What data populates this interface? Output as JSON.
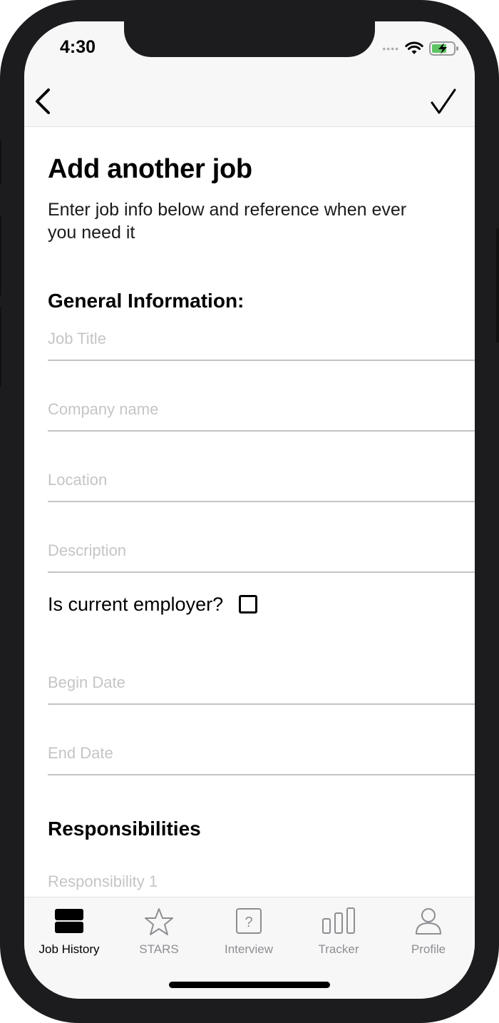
{
  "status_bar": {
    "time": "4:30",
    "icons": [
      "signal-dots-icon",
      "wifi-icon",
      "battery-charging-icon"
    ],
    "battery_color": "#5fc463"
  },
  "nav": {
    "back_icon": "chevron-left-icon",
    "done_icon": "checkmark-icon"
  },
  "page": {
    "title": "Add another job",
    "subtitle": "Enter job info below and reference when ever you need it"
  },
  "general": {
    "heading": "General Information:",
    "fields": [
      {
        "placeholder": "Job Title",
        "value": ""
      },
      {
        "placeholder": "Company name",
        "value": ""
      },
      {
        "placeholder": "Location",
        "value": ""
      },
      {
        "placeholder": "Description",
        "value": ""
      }
    ],
    "current_employer_label": "Is current employer?",
    "current_employer_checked": false,
    "date_fields": [
      {
        "placeholder": "Begin Date",
        "value": ""
      },
      {
        "placeholder": "End Date",
        "value": ""
      }
    ]
  },
  "responsibilities": {
    "heading": "Responsibilities",
    "fields": [
      {
        "placeholder": "Responsibility 1",
        "value": ""
      }
    ]
  },
  "tab_bar": {
    "active": "Job History",
    "tabs": [
      {
        "label": "Job History",
        "icon": "job-history-icon"
      },
      {
        "label": "STARS",
        "icon": "star-icon"
      },
      {
        "label": "Interview",
        "icon": "question-icon"
      },
      {
        "label": "Tracker",
        "icon": "bar-chart-icon"
      },
      {
        "label": "Profile",
        "icon": "person-icon"
      }
    ]
  },
  "colors": {
    "background": "#ffffff",
    "bar_background": "#f7f7f7",
    "placeholder": "#c5c5c5",
    "inactive_tab": "#8e8e93",
    "active_tab": "#000000"
  }
}
